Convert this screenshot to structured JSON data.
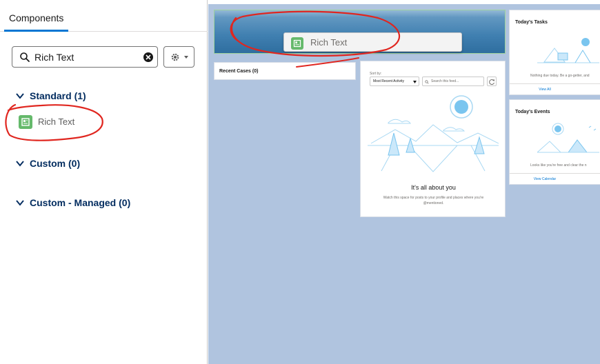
{
  "left_panel": {
    "tab_label": "Components",
    "search": {
      "value": "Rich Text"
    },
    "sections": [
      {
        "label": "Standard (1)",
        "items": [
          "Rich Text"
        ]
      },
      {
        "label": "Custom (0)",
        "items": []
      },
      {
        "label": "Custom - Managed (0)",
        "items": []
      }
    ]
  },
  "canvas": {
    "drag_chip_label": "Rich Text",
    "recent_cases_title": "Recent Cases (0)",
    "feed": {
      "sort_label": "Sort by:",
      "sort_value": "Most Recent Activity",
      "search_placeholder": "Search this feed...",
      "heading": "It's all about you",
      "message": "Watch this space for posts to your profile and places where you're @mentioned."
    },
    "tasks": {
      "title": "Today's Tasks",
      "message": "Nothing due today. Be a go-getter, and",
      "link": "View All"
    },
    "events": {
      "title": "Today's Events",
      "message": "Looks like you're free and clear the n",
      "link": "View Calendar"
    }
  },
  "colors": {
    "accent": "#0176d3",
    "section_text": "#032d60",
    "annotation": "#e0261f",
    "component_icon": "#65b96b"
  }
}
